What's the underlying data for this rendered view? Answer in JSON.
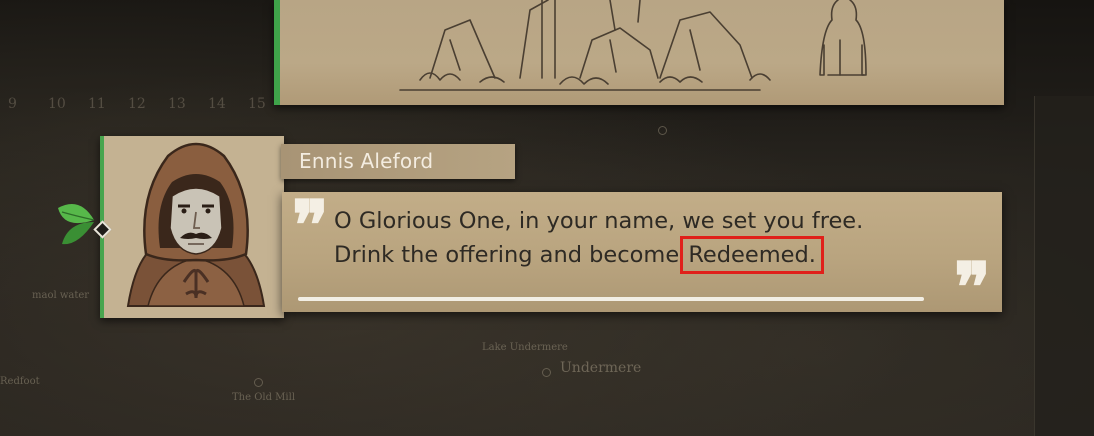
{
  "map": {
    "timeline_numbers": [
      "9",
      "10",
      "11",
      "12",
      "13",
      "14",
      "15"
    ],
    "labels": [
      "Ennis Aleford",
      "maol water",
      "Lake Undermere",
      "Undermere",
      "The Old Mill",
      "Redfoot"
    ]
  },
  "speaker": {
    "name": "Ennis Aleford"
  },
  "dialogue": {
    "open_quote": "❞",
    "close_quote": "❞",
    "line1": "O Glorious One, in your name, we set you free.",
    "line2_before": "Drink the offering and become ",
    "highlight": "Redeemed.",
    "progress": 1.0
  },
  "colors": {
    "accent_green": "#3fa34a",
    "highlight_red": "#e0201a",
    "parchment": "#bfa985"
  }
}
